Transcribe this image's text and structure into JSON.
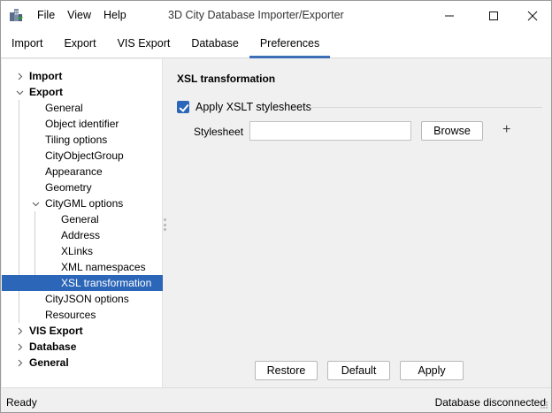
{
  "window": {
    "title": "3D City Database Importer/Exporter",
    "menu": [
      "File",
      "View",
      "Help"
    ]
  },
  "tabs": [
    {
      "label": "Import",
      "active": false
    },
    {
      "label": "Export",
      "active": false
    },
    {
      "label": "VIS Export",
      "active": false
    },
    {
      "label": "Database",
      "active": false
    },
    {
      "label": "Preferences",
      "active": true
    }
  ],
  "tree": [
    {
      "label": "Import",
      "level": 0,
      "bold": true,
      "state": "collapsed"
    },
    {
      "label": "Export",
      "level": 0,
      "bold": true,
      "state": "expanded"
    },
    {
      "label": "General",
      "level": 1
    },
    {
      "label": "Object identifier",
      "level": 1
    },
    {
      "label": "Tiling options",
      "level": 1
    },
    {
      "label": "CityObjectGroup",
      "level": 1
    },
    {
      "label": "Appearance",
      "level": 1
    },
    {
      "label": "Geometry",
      "level": 1
    },
    {
      "label": "CityGML options",
      "level": 1,
      "state": "expanded"
    },
    {
      "label": "General",
      "level": 2
    },
    {
      "label": "Address",
      "level": 2
    },
    {
      "label": "XLinks",
      "level": 2
    },
    {
      "label": "XML namespaces",
      "level": 2
    },
    {
      "label": "XSL transformation",
      "level": 2,
      "selected": true
    },
    {
      "label": "CityJSON options",
      "level": 1
    },
    {
      "label": "Resources",
      "level": 1
    },
    {
      "label": "VIS Export",
      "level": 0,
      "bold": true,
      "state": "collapsed"
    },
    {
      "label": "Database",
      "level": 0,
      "bold": true,
      "state": "collapsed"
    },
    {
      "label": "General",
      "level": 0,
      "bold": true,
      "state": "collapsed"
    }
  ],
  "panel": {
    "title": "XSL transformation",
    "apply_xslt_label": "Apply XSLT stylesheets",
    "apply_xslt_checked": true,
    "stylesheet_label": "Stylesheet",
    "stylesheet_value": "",
    "browse_label": "Browse",
    "add_symbol": "+",
    "restore_label": "Restore",
    "default_label": "Default",
    "apply_label": "Apply"
  },
  "status": {
    "left": "Ready",
    "right": "Database disconnected"
  },
  "colors": {
    "accent": "#2c66b8",
    "tab_underline": "#3c6fb6"
  }
}
